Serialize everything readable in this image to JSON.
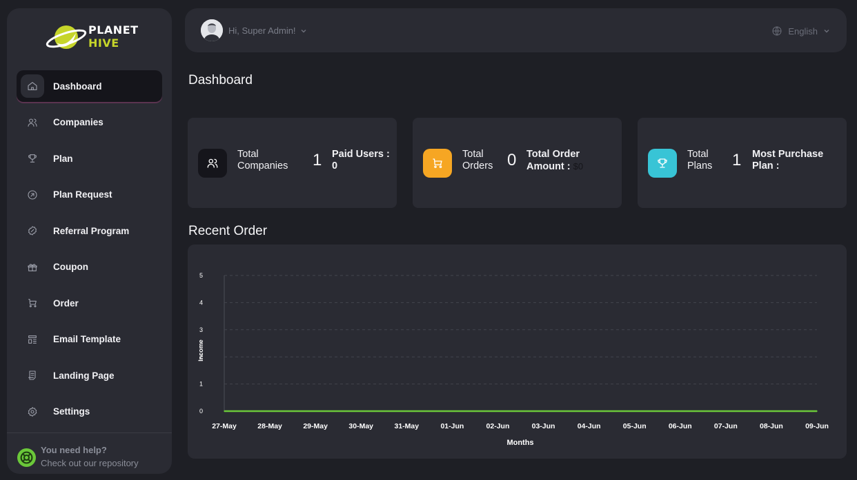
{
  "brand": {
    "line1": "PLANET",
    "line2": "HIVE"
  },
  "sidebar": {
    "items": [
      {
        "label": "Dashboard",
        "icon": "home-icon",
        "active": true
      },
      {
        "label": "Companies",
        "icon": "users-icon"
      },
      {
        "label": "Plan",
        "icon": "trophy-icon"
      },
      {
        "label": "Plan Request",
        "icon": "arrow-circle-icon"
      },
      {
        "label": "Referral Program",
        "icon": "discount-icon"
      },
      {
        "label": "Coupon",
        "icon": "gift-icon"
      },
      {
        "label": "Order",
        "icon": "cart-icon"
      },
      {
        "label": " Email Template",
        "icon": "template-icon"
      },
      {
        "label": "Landing Page",
        "icon": "file-icon"
      },
      {
        "label": "Settings",
        "icon": "gear-icon"
      }
    ],
    "help": {
      "title": "You need help?",
      "subtitle": "Check out our repository"
    }
  },
  "header": {
    "greeting": "Hi, Super Admin!",
    "language": "English"
  },
  "page_title": "Dashboard",
  "stats": [
    {
      "label_line1": "Total",
      "label_line2": "Companies",
      "value": "1",
      "side_line1": "Paid Users :",
      "side_line2": "0",
      "color": "#15151b"
    },
    {
      "label_line1": "Total",
      "label_line2": "Orders",
      "value": "0",
      "side_line1": "Total Order",
      "side_line2": "Amount :",
      "side_extra": "$0",
      "color": "#f6a623"
    },
    {
      "label_line1": "Total",
      "label_line2": "Plans",
      "value": "1",
      "side_line1": "Most Purchase",
      "side_line2": "Plan :",
      "color": "#38c4d6"
    }
  ],
  "recent_order_title": "Recent Order",
  "chart_data": {
    "type": "line",
    "x": [
      "27-May",
      "28-May",
      "29-May",
      "30-May",
      "31-May",
      "01-Jun",
      "02-Jun",
      "03-Jun",
      "04-Jun",
      "05-Jun",
      "06-Jun",
      "07-Jun",
      "08-Jun",
      "09-Jun"
    ],
    "series": [
      {
        "values": [
          0,
          0,
          0,
          0,
          0,
          0,
          0,
          0,
          0,
          0,
          0,
          0,
          0,
          0
        ],
        "color": "#6bc83a"
      }
    ],
    "xlabel": "Months",
    "ylabel": "Income",
    "ylim": [
      0,
      5
    ],
    "yticks": [
      0,
      1,
      2,
      3,
      4,
      5
    ],
    "grid": true
  }
}
